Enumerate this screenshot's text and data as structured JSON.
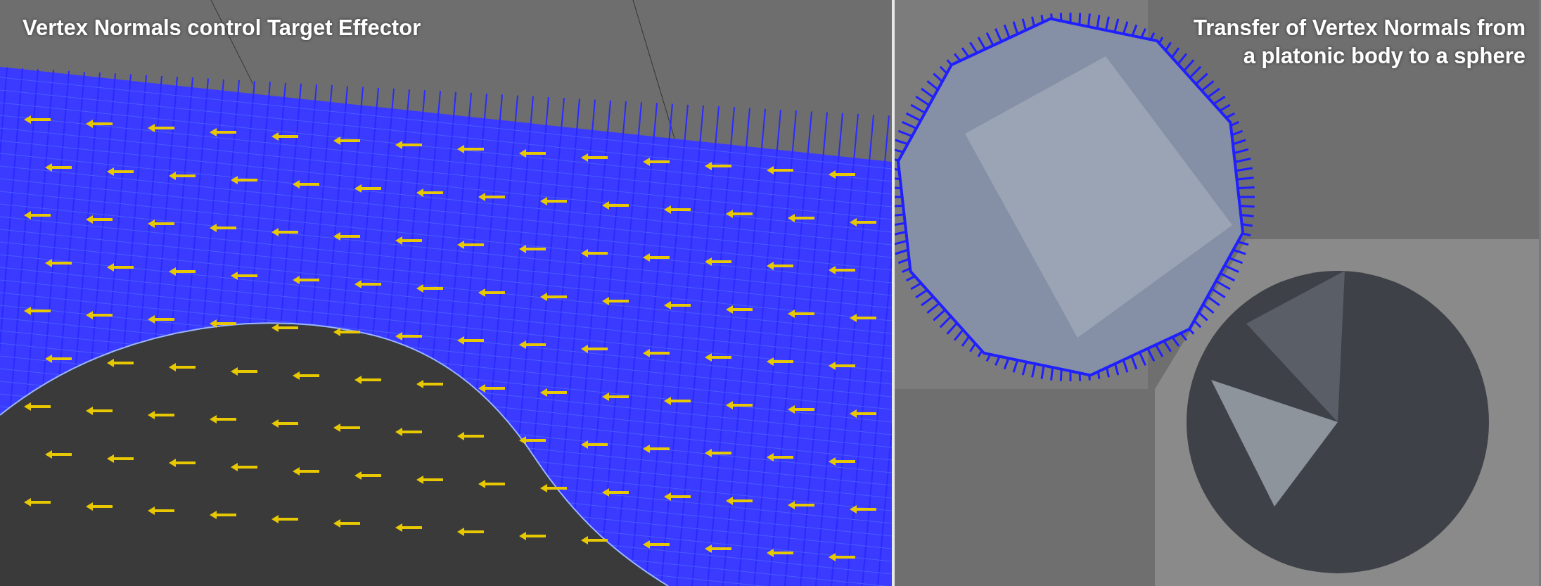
{
  "panels": [
    {
      "kind": "plane",
      "title_lines": [
        "Vertex Normals control Target Effector"
      ]
    },
    {
      "kind": "platonic",
      "title_lines": [
        "Transfer of Vertex Normals from",
        "a platonic body to a sphere"
      ]
    }
  ]
}
